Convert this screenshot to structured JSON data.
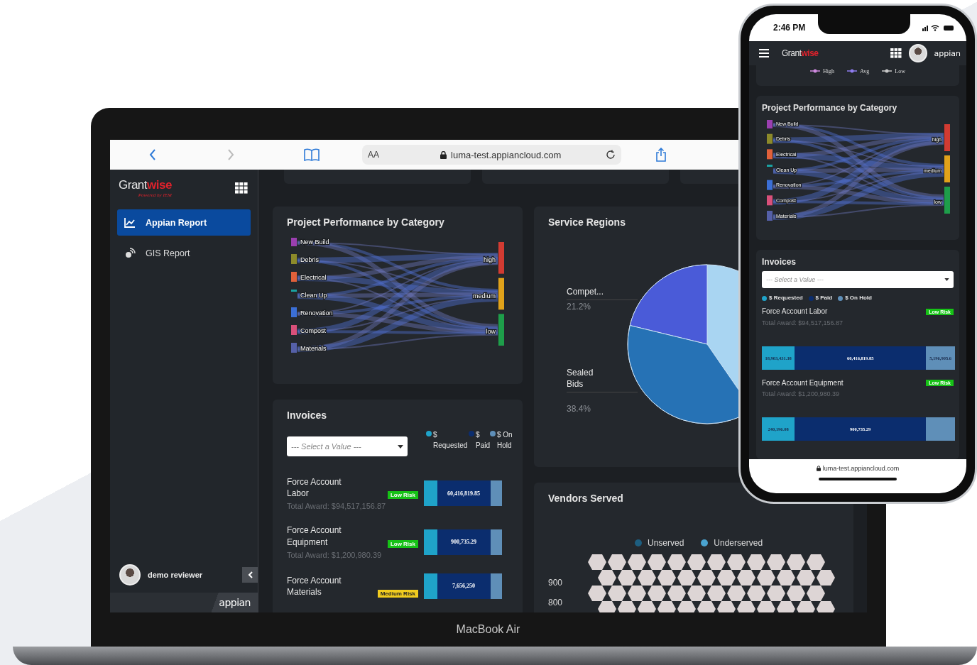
{
  "browser": {
    "text_size": "AA",
    "url": "luma-test.appiancloud.com"
  },
  "sidebar": {
    "logo": {
      "part1": "Grant",
      "part2": "wise",
      "tagline": "Powered by IEM"
    },
    "items": [
      {
        "label": "Appian Report",
        "selected": true
      },
      {
        "label": "GIS Report",
        "selected": false
      }
    ],
    "user": "demo reviewer",
    "footer": "appian"
  },
  "project_performance": {
    "title": "Project Performance by Category",
    "sources": [
      {
        "label": "New Build",
        "color": "#9b3fb0"
      },
      {
        "label": "Debris",
        "color": "#8c8a2a"
      },
      {
        "label": "Electrical",
        "color": "#e0603a"
      },
      {
        "label": "Clean Up",
        "color": "#1aa3a3"
      },
      {
        "label": "Renovation",
        "color": "#3b6fd6"
      },
      {
        "label": "Compost",
        "color": "#d9507a"
      },
      {
        "label": "Materials",
        "color": "#5560a8"
      }
    ],
    "targets": [
      {
        "label": "high",
        "color": "#d23b32"
      },
      {
        "label": "medium",
        "color": "#e0a21a"
      },
      {
        "label": "low",
        "color": "#1e9e4a"
      }
    ]
  },
  "invoices": {
    "title": "Invoices",
    "placeholder": "--- Select a Value ---",
    "legend": [
      {
        "label": "$ Requested",
        "color": "#1fa3c9"
      },
      {
        "label": "$ Paid",
        "color": "#0b2d6e"
      },
      {
        "label": "$ On Hold",
        "color": "#5f8fb8"
      }
    ],
    "items": [
      {
        "name": "Force Account Labor",
        "risk": "Low Risk",
        "color": "#16c216",
        "total": "Total Award: $94,517,156.87",
        "segments": [
          {
            "kind": "requested"
          },
          {
            "kind": "paid",
            "value": "60,416,819.85"
          },
          {
            "kind": "on_hold"
          }
        ]
      },
      {
        "name": "Force Account Equipment",
        "risk": "Low Risk",
        "color": "#16c216",
        "total": "Total Award: $1,200,980.39",
        "segments": [
          {
            "kind": "requested"
          },
          {
            "kind": "paid",
            "value": "900,735.29"
          },
          {
            "kind": "on_hold"
          }
        ]
      },
      {
        "name": "Force Account Materials",
        "risk": "Medium Risk",
        "color": "#f1cc1f",
        "segments": [
          {
            "kind": "requested"
          },
          {
            "kind": "paid",
            "value": "7,656,250"
          },
          {
            "kind": "on_hold"
          }
        ]
      }
    ]
  },
  "service_regions": {
    "title": "Service Regions",
    "chart_data": {
      "type": "pie",
      "categories": [
        "Compet...",
        "Sealed Bids"
      ],
      "values": [
        21.2,
        38.4
      ],
      "value_labels": [
        "21.2%",
        "38.4%"
      ]
    }
  },
  "vendors": {
    "title": "Vendors Served",
    "legend": [
      {
        "label": "Unserved",
        "color": "#1d5e80"
      },
      {
        "label": "Underserved",
        "color": "#4aa3cf"
      }
    ],
    "y_labels": [
      "900",
      "800"
    ]
  },
  "device": {
    "label": "MacBook Air"
  },
  "phone": {
    "time": "2:46 PM",
    "logo": {
      "part1": "Grant",
      "part2": "wise"
    },
    "brand": "appian",
    "url": "luma-test.appiancloud.com",
    "legend": [
      {
        "label": "High",
        "color": "#d08ae0"
      },
      {
        "label": "Avg",
        "color": "#8f7cf0"
      },
      {
        "label": "Low",
        "color": "#c8c8c8"
      }
    ],
    "project_performance": {
      "title": "Project Performance by Category",
      "sources": [
        {
          "label": "New Build",
          "color": "#9b3fb0"
        },
        {
          "label": "Debris",
          "color": "#8c8a2a"
        },
        {
          "label": "Electrical",
          "color": "#e0603a"
        },
        {
          "label": "Clean Up",
          "color": "#1aa3a3"
        },
        {
          "label": "Renovation",
          "color": "#3b6fd6"
        },
        {
          "label": "Compost",
          "color": "#d9507a"
        },
        {
          "label": "Materials",
          "color": "#5560a8"
        }
      ],
      "targets": [
        {
          "label": "high",
          "color": "#d23b32"
        },
        {
          "label": "medium",
          "color": "#e0a21a"
        },
        {
          "label": "low",
          "color": "#1e9e4a"
        }
      ]
    },
    "invoices": {
      "title": "Invoices",
      "placeholder": "--- Select a Value ---",
      "legend": [
        {
          "label": "$ Requested",
          "color": "#1fa3c9"
        },
        {
          "label": "$ Paid",
          "color": "#0b2d6e"
        },
        {
          "label": "$ On Hold",
          "color": "#5f8fb8"
        }
      ],
      "items": [
        {
          "name": "Force Account Labor",
          "risk": "Low Risk",
          "color": "#16c216",
          "total": "Total Award: $94,517,156.87",
          "segments": [
            {
              "kind": "requested",
              "value": "18,903,431.38"
            },
            {
              "kind": "paid",
              "value": "60,416,819.85"
            },
            {
              "kind": "on_hold",
              "value": "5,196,905.6"
            }
          ]
        },
        {
          "name": "Force Account Equipment",
          "risk": "Low Risk",
          "color": "#16c216",
          "total": "Total Award: $1,200,980.39",
          "segments": [
            {
              "kind": "requested",
              "value": "240,196.08"
            },
            {
              "kind": "paid",
              "value": "900,735.29"
            },
            {
              "kind": "on_hold"
            }
          ]
        }
      ]
    }
  }
}
